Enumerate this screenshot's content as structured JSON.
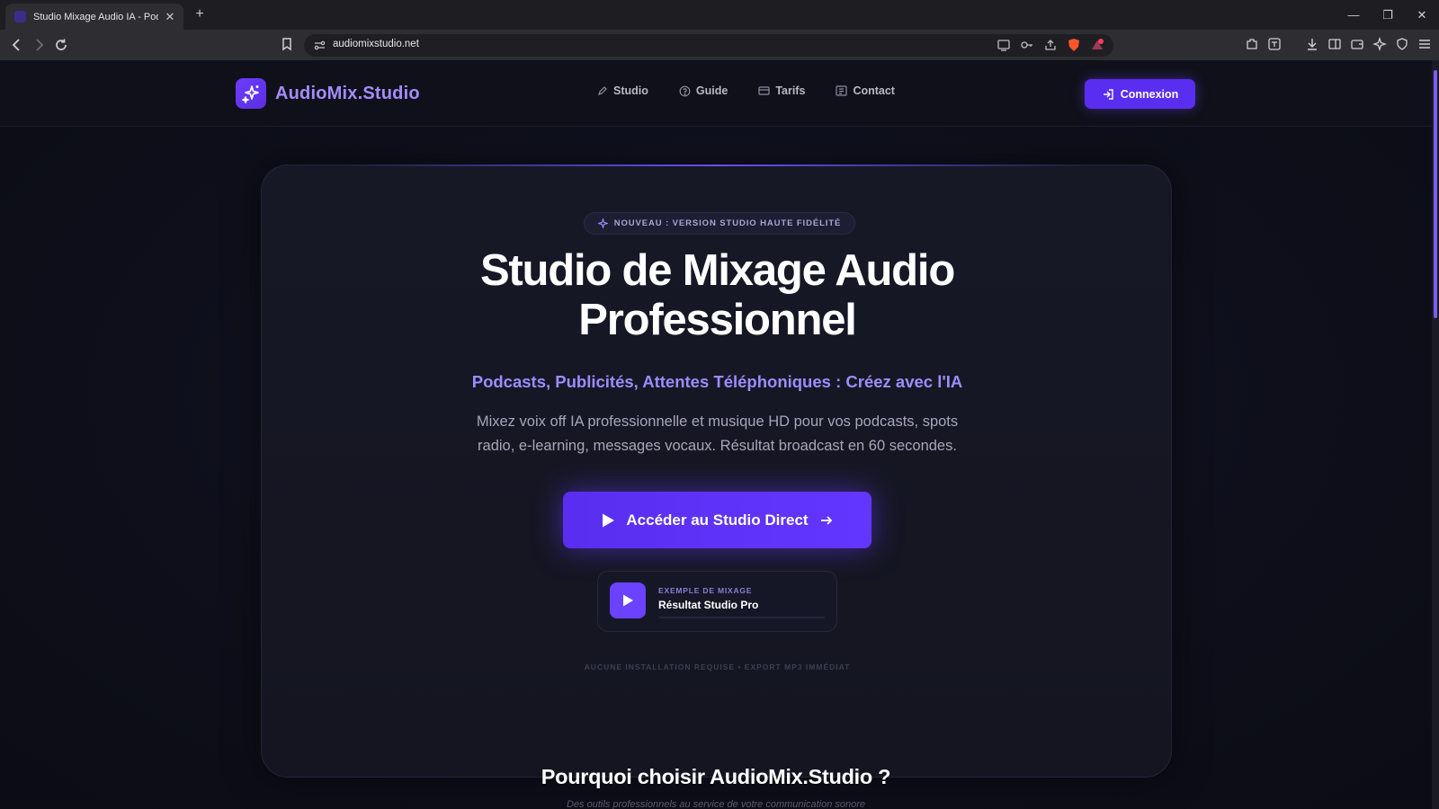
{
  "browser": {
    "tab_title": "Studio Mixage Audio IA - Podcast",
    "url": "audiomixstudio.net"
  },
  "site": {
    "logo_text": "AudioMix.Studio",
    "nav": [
      {
        "label": "Studio",
        "icon": "pen-icon"
      },
      {
        "label": "Guide",
        "icon": "help-circle-icon"
      },
      {
        "label": "Tarifs",
        "icon": "card-icon"
      },
      {
        "label": "Contact",
        "icon": "contact-card-icon"
      }
    ],
    "login_label": "Connexion"
  },
  "hero": {
    "badge": "NOUVEAU : VERSION STUDIO HAUTE FIDÉLITÉ",
    "title_line1": "Studio de Mixage Audio",
    "title_line2": "Professionnel",
    "subtitle": "Podcasts, Publicités, Attentes Téléphoniques : Créez avec l'IA",
    "description": "Mixez voix off IA professionnelle et musique HD pour vos podcasts, spots radio, e-learning, messages vocaux. Résultat broadcast en 60 secondes.",
    "cta_label": "Accéder au Studio Direct",
    "sample_tag": "EXEMPLE DE MIXAGE",
    "sample_title": "Résultat Studio Pro",
    "footnote": "AUCUNE INSTALLATION REQUISE • EXPORT MP3 IMMÉDIAT"
  },
  "why": {
    "title": "Pourquoi choisir AudioMix.Studio ?",
    "subtitle": "Des outils professionnels au service de votre communication sonore"
  },
  "colors": {
    "accent": "#5a2ef0",
    "accent_light": "#9e8cff",
    "background": "#0e0f1b"
  }
}
